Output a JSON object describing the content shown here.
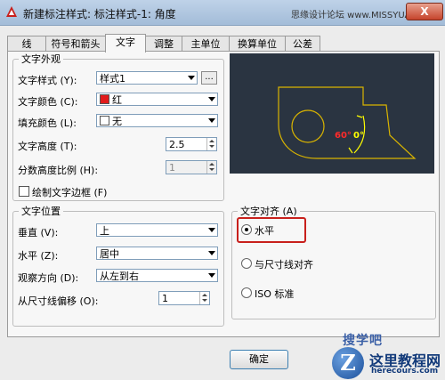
{
  "window": {
    "title": "新建标注样式: 标注样式-1: 角度",
    "watermark": "思缘设计论坛  www.MISSYUAN.COM",
    "close_glyph": "X"
  },
  "tabs": [
    "线",
    "符号和箭头",
    "文字",
    "调整",
    "主单位",
    "换算单位",
    "公差"
  ],
  "text_appearance": {
    "legend": "文字外观",
    "style_label": "文字样式 (Y):",
    "style_value": "样式1",
    "browse_label": "...",
    "color_label": "文字颜色 (C):",
    "color_value": "红",
    "color_swatch": "#e11b1b",
    "fill_label": "填充颜色 (L):",
    "fill_value": "无",
    "height_label": "文字高度 (T):",
    "height_value": "2.5",
    "fraction_label": "分数高度比例 (H):",
    "fraction_value": "1",
    "frame_label": "绘制文字边框 (F)"
  },
  "text_placement": {
    "legend": "文字位置",
    "vertical_label": "垂直 (V):",
    "vertical_value": "上",
    "horizontal_label": "水平 (Z):",
    "horizontal_value": "居中",
    "view_dir_label": "观察方向 (D):",
    "view_dir_value": "从左到右",
    "offset_label": "从尺寸线偏移 (O):",
    "offset_value": "1"
  },
  "text_alignment": {
    "legend": "文字对齐 (A)",
    "opt_horizontal": "水平",
    "opt_aligned": "与尺寸线对齐",
    "opt_iso": "ISO 标准",
    "selected": "水平"
  },
  "preview": {
    "angle_label_1": "60°",
    "angle_label_2": "0°",
    "line_color": "#d9b400",
    "dim_color": "#ffff00",
    "text_color": "#ff2a2a"
  },
  "footer": {
    "ok_label": "确定"
  },
  "logo": {
    "brand": "搜学吧",
    "letter": "Z",
    "name": "这里教程网",
    "url": "herecours.com"
  }
}
